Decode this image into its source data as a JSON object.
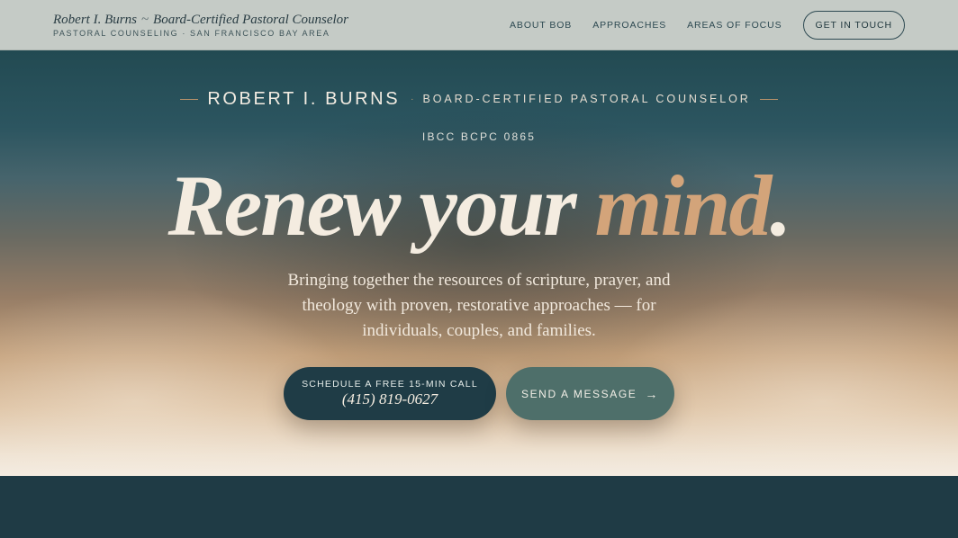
{
  "header": {
    "name": "Robert I. Burns",
    "separator": "~",
    "credential": "Board-Certified Pastoral Counselor",
    "subtitle": "PASTORAL COUNSELING · SAN FRANCISCO BAY AREA",
    "nav": [
      "ABOUT BOB",
      "APPROACHES",
      "AREAS OF FOCUS"
    ],
    "cta_label": "GET IN TOUCH"
  },
  "hero": {
    "name": "ROBERT I. BURNS",
    "dot": "·",
    "title": "BOARD-CERTIFIED PASTORAL COUNSELOR",
    "cert": "IBCC BCPC 0865",
    "headline_part1": "Renew your ",
    "headline_accent": "mind",
    "headline_end": ".",
    "lede": "Bringing together the resources of scripture, prayer, and theology with proven, restorative approaches — for individuals, couples, and families.",
    "call_label": "SCHEDULE A FREE 15-MIN CALL",
    "phone": "(415) 819-0627",
    "message_label": "SEND A MESSAGE",
    "message_arrow": "→"
  },
  "colors": {
    "accent": "#d3a47a",
    "dark_teal": "#1f3c46",
    "sage": "#4e6f6a",
    "cream": "#f4ece0"
  }
}
